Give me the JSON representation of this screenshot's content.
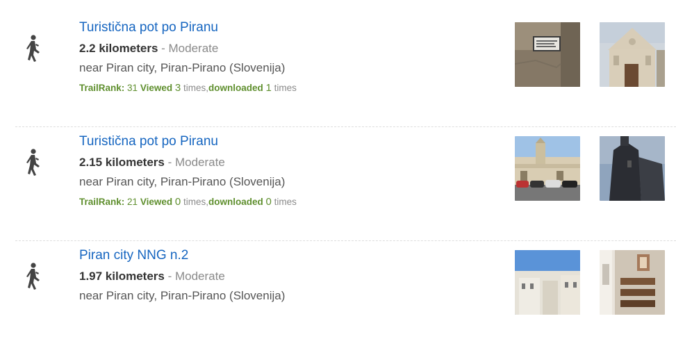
{
  "trails": [
    {
      "title": "Turistična pot po Piranu",
      "distance": "2.2 kilometers",
      "separator": " - ",
      "difficulty": "Moderate",
      "location": "near Piran city, Piran-Pirano (Slovenija)",
      "stats": {
        "trailrank_label": "TrailRank:",
        "trailrank": "31",
        "viewed_label": "Viewed",
        "viewed": "3",
        "times1": "times,",
        "downloaded_label": "downloaded",
        "downloaded": "1",
        "times2": "times"
      },
      "icon": "hiker-icon"
    },
    {
      "title": "Turistična pot po Piranu",
      "distance": "2.15 kilometers",
      "separator": " - ",
      "difficulty": "Moderate",
      "location": "near Piran city, Piran-Pirano (Slovenija)",
      "stats": {
        "trailrank_label": "TrailRank:",
        "trailrank": "21",
        "viewed_label": "Viewed",
        "viewed": "0",
        "times1": "times,",
        "downloaded_label": "downloaded",
        "downloaded": "0",
        "times2": "times"
      },
      "icon": "hiker-icon"
    },
    {
      "title": "Piran city NNG n.2",
      "distance": "1.97 kilometers",
      "separator": " - ",
      "difficulty": "Moderate",
      "location": "near Piran city, Piran-Pirano (Slovenija)",
      "icon": "hiker-icon"
    }
  ],
  "colors": {
    "link": "#1565c0",
    "stats_green": "#5f8f2e",
    "muted": "#8a8a8a"
  }
}
